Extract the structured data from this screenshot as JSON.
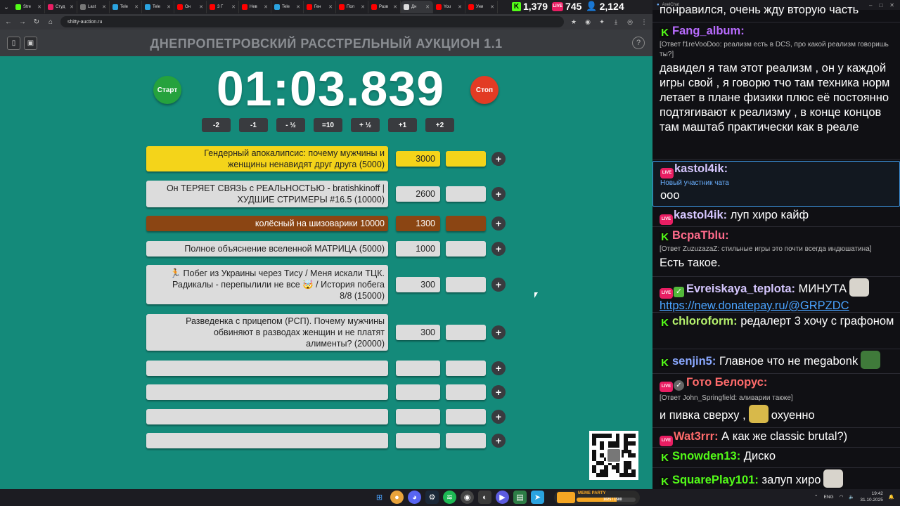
{
  "browser": {
    "tabs": [
      {
        "label": "Stre",
        "color": "#53fc18"
      },
      {
        "label": "Студ",
        "color": "#e91e63"
      },
      {
        "label": "Last",
        "color": "#777777"
      },
      {
        "label": "Tele",
        "color": "#2aa3e0"
      },
      {
        "label": "Tele",
        "color": "#2aa3e0"
      },
      {
        "label": "Он",
        "color": "#ff0000"
      },
      {
        "label": "3 Г",
        "color": "#ff0000"
      },
      {
        "label": "Нев",
        "color": "#ff0000"
      },
      {
        "label": "Tele",
        "color": "#2aa3e0"
      },
      {
        "label": "Ген",
        "color": "#ff0000"
      },
      {
        "label": "Пол",
        "color": "#ff0000"
      },
      {
        "label": "Разв",
        "color": "#ff0000"
      },
      {
        "label": "Дн",
        "color": "#dddddd",
        "active": true
      },
      {
        "label": "You",
        "color": "#ff0000"
      },
      {
        "label": "Уни",
        "color": "#ff0000"
      }
    ],
    "url": "shitty-auction.ru"
  },
  "stream_stats": {
    "kick_viewers": "1,379",
    "live_viewers": "745",
    "total_viewers": "2,124"
  },
  "auction": {
    "title": "ДНЕПРОПЕТРОВСКИЙ РАССТРЕЛЬНЫЙ АУКЦИОН 1.1",
    "start_label": "Старт",
    "stop_label": "Стоп",
    "timer": "01:03.839",
    "adjust_buttons": [
      "-2",
      "-1",
      "- ½",
      "=10",
      "+ ½",
      "+1",
      "+2"
    ],
    "lots": [
      {
        "lines": [
          "Гендерный апокалипсис: почему мужчины и",
          "женщины ненавидят друг друга (5000)"
        ],
        "amount": "3000",
        "style": "yellow"
      },
      {
        "lines": [
          "Он ТЕРЯЕТ СВЯЗЬ с РЕАЛЬНОСТЬЮ - bratishkinoff |",
          "ХУДШИЕ СТРИМЕРЫ #16.5 (10000)"
        ],
        "amount": "2600",
        "style": "grey"
      },
      {
        "lines": [
          "колёсный на шизоварики 10000"
        ],
        "amount": "1300",
        "style": "brown"
      },
      {
        "lines": [
          "Полное объяснение вселенной МАТРИЦА (5000)"
        ],
        "amount": "1000",
        "style": "grey"
      },
      {
        "lines": [
          "🏃 Побег из Украины через Тису / Меня искали ТЦК.",
          "Радикалы - перепылили не все 🤯 / История побега",
          "8/8 (15000)"
        ],
        "amount": "300",
        "style": "grey"
      },
      {
        "lines": [
          "Разведенка с прицепом (РСП). Почему мужчины",
          "обвиняют в разводах женщин и не платят",
          "алименты? (20000)"
        ],
        "amount": "300",
        "style": "grey"
      },
      {
        "lines": [],
        "amount": "",
        "style": "grey"
      },
      {
        "lines": [],
        "amount": "",
        "style": "grey"
      },
      {
        "lines": [],
        "amount": "",
        "style": "grey"
      },
      {
        "lines": [],
        "amount": "",
        "style": "grey"
      }
    ]
  },
  "chat": {
    "window_title": "AxelChat",
    "messages": [
      {
        "text": "понравился, очень жду вторую часть"
      },
      {
        "platform": "kick",
        "user": "Fang_album",
        "user_color": "#b96cff",
        "reply": "[Ответ f1reVooDoo: реализм есть в DCS, про какой реализм говоришь ты?]",
        "text": "давидел я там этот реализм , он у каждой игры свой , я говорю тчо там техника норм летает в плане физики плюс её постоянно подтягивают к реализму , в конце концов там маштаб практически как в реале"
      },
      {
        "platform": "live",
        "user": "kastol4ik",
        "user_color": "#d6c7ff",
        "sub": "Новый участник чата",
        "text": "ооо",
        "highlight": true
      },
      {
        "platform": "live",
        "user": "kastol4ik",
        "user_color": "#d6c7ff",
        "text": "луп хиро кайф"
      },
      {
        "platform": "kick",
        "user": "BcpaTblu",
        "user_color": "#ff6b8b",
        "reply": "[Ответ ZuzuzazaZ: стильные игры это почти всегда индюшатина]",
        "text": "Есть такое."
      },
      {
        "platform": "live",
        "user": "Evreiskaya_teplota",
        "user_color": "#d6c7ff",
        "text": "МИНУТА",
        "link": "https://new.donatepay.ru/@GRPZDC"
      },
      {
        "platform": "kick",
        "user": "chloroform",
        "user_color": "#b6f26d",
        "text": "редалерт 3 хочу с графоном"
      },
      {
        "platform": "kick",
        "user": "senjin5",
        "user_color": "#8aa8ff",
        "text": "Главное что не megabonk"
      },
      {
        "platform": "live",
        "user": "Гото Белорус",
        "user_color": "#ff6b6b",
        "reply": "[Ответ John_Springfield: аливарии также]",
        "text": "и пивка сверху ,",
        "text2": "охуенно"
      },
      {
        "platform": "live",
        "user": "Wat3rrr",
        "user_color": "#ff6b6b",
        "text": "А как же classic brutal?)"
      },
      {
        "platform": "kick",
        "user": "Snowden13",
        "user_color": "#53fc18",
        "text": "Диско"
      },
      {
        "platform": "kick",
        "user": "SquarePlay101",
        "user_color": "#53fc18",
        "text": "залуп хиро"
      }
    ]
  },
  "taskbar": {
    "meme_label": "MEME PARTY",
    "meme_progress": "1025 / 1500",
    "meme_fraction": 0.683,
    "lang": "ENG",
    "time": "19:42",
    "date": "31.10.2025"
  }
}
